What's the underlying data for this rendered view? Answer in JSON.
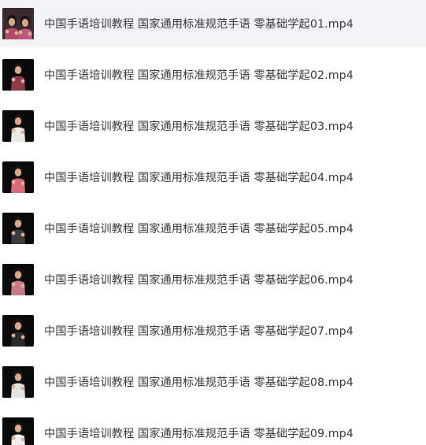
{
  "files": [
    {
      "name": "中国手语培训教程 国家通用标准规范手语 零基础学起01.mp4",
      "thumb": "video-thumbnail-two-signers",
      "selected": true
    },
    {
      "name": "中国手语培训教程 国家通用标准规范手语 零基础学起02.mp4",
      "thumb": "video-thumbnail-signer",
      "selected": false
    },
    {
      "name": "中国手语培训教程 国家通用标准规范手语 零基础学起03.mp4",
      "thumb": "video-thumbnail-signer",
      "selected": false
    },
    {
      "name": "中国手语培训教程 国家通用标准规范手语 零基础学起04.mp4",
      "thumb": "video-thumbnail-signer",
      "selected": false
    },
    {
      "name": "中国手语培训教程 国家通用标准规范手语 零基础学起05.mp4",
      "thumb": "video-thumbnail-signer",
      "selected": false
    },
    {
      "name": "中国手语培训教程 国家通用标准规范手语 零基础学起06.mp4",
      "thumb": "video-thumbnail-signer",
      "selected": false
    },
    {
      "name": "中国手语培训教程 国家通用标准规范手语 零基础学起07.mp4",
      "thumb": "video-thumbnail-signer",
      "selected": false
    },
    {
      "name": "中国手语培训教程 国家通用标准规范手语 零基础学起08.mp4",
      "thumb": "video-thumbnail-signer",
      "selected": false
    },
    {
      "name": "中国手语培训教程 国家通用标准规范手语 零基础学起09.mp4",
      "thumb": "video-thumbnail-signer",
      "selected": false
    }
  ],
  "colors": {
    "selected_row_bg": "#f3f3f5",
    "text": "#3a3a3c",
    "thumb_bg": "#0a0a0a"
  }
}
